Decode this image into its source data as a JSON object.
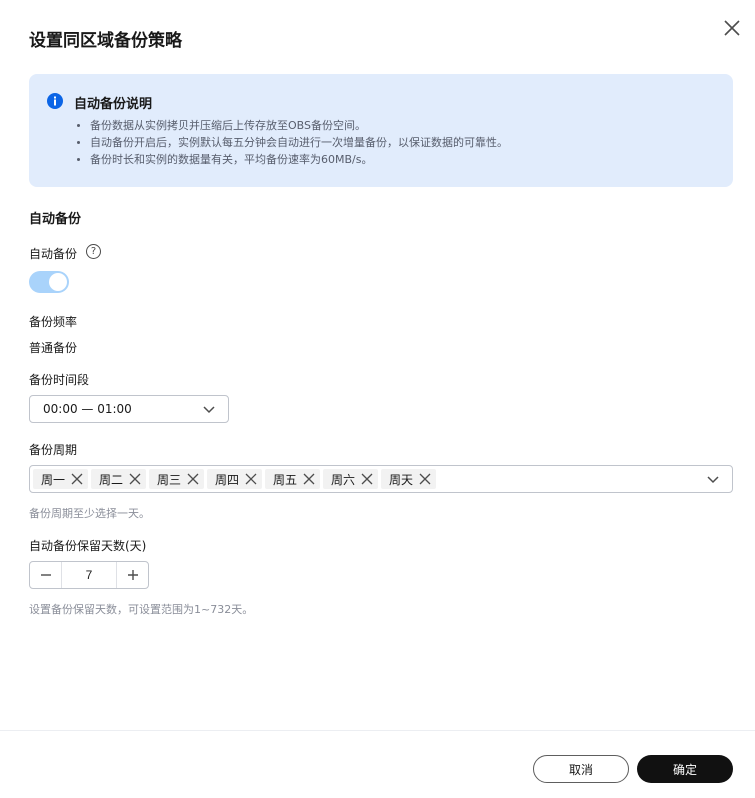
{
  "dialog": {
    "title": "设置同区域备份策略"
  },
  "notice": {
    "title": "自动备份说明",
    "items": [
      "备份数据从实例拷贝并压缩后上传存放至OBS备份空间。",
      "自动备份开启后，实例默认每五分钟会自动进行一次增量备份，以保证数据的可靠性。",
      "备份时长和实例的数据量有关，平均备份速率为60MB/s。"
    ]
  },
  "section": {
    "title": "自动备份"
  },
  "auto_backup": {
    "label": "自动备份",
    "help_icon": "?",
    "enabled": true
  },
  "frequency": {
    "label": "备份频率",
    "value": "普通备份"
  },
  "time_window": {
    "label": "备份时间段",
    "value": "00:00 — 01:00"
  },
  "cycle": {
    "label": "备份周期",
    "tags": [
      "周一",
      "周二",
      "周三",
      "周四",
      "周五",
      "周六",
      "周天"
    ],
    "hint": "备份周期至少选择一天。"
  },
  "retention": {
    "label": "自动备份保留天数(天)",
    "value": "7",
    "hint": "设置备份保留天数，可设置范围为1~732天。"
  },
  "footer": {
    "cancel_label": "取消",
    "ok_label": "确定"
  },
  "colors": {
    "notice_bg": "#e1ecfc",
    "info_icon": "#0b65e6",
    "toggle_on": "#a9d3fb",
    "primary_button": "#111111"
  }
}
